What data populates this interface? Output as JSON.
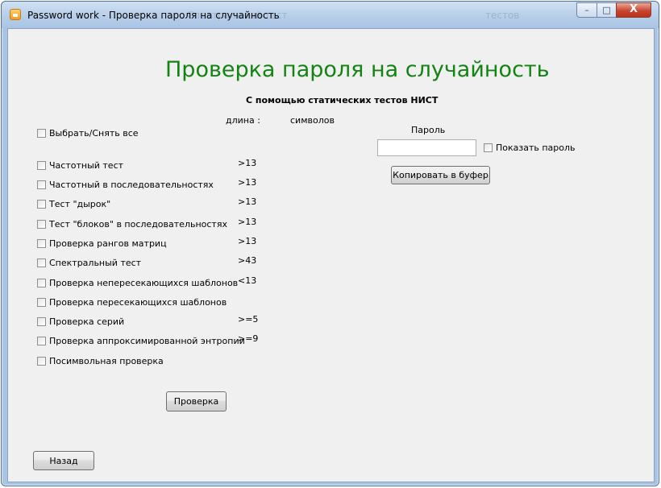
{
  "window": {
    "title": "Password work - Проверка пароля на случайность",
    "ghost_tabs": [
      "Спектральный тест",
      "тестов"
    ],
    "controls": {
      "minimize": "–",
      "maximize": "□",
      "close": "X"
    }
  },
  "header": {
    "title": "Проверка пароля на случайность",
    "subtitle": "С помощью статических тестов НИСТ"
  },
  "length": {
    "label": "длина :",
    "value": "",
    "unit": "символов"
  },
  "select_all_label": "Выбрать/Снять все",
  "tests": [
    {
      "label": "Частотный тест",
      "threshold": ">13"
    },
    {
      "label": "Частотный в последовательностях",
      "threshold": ">13"
    },
    {
      "label": "Тест \"дырок\"",
      "threshold": ">13"
    },
    {
      "label": "Тест \"блоков\" в последовательностях",
      "threshold": ">13"
    },
    {
      "label": "Проверка рангов матриц",
      "threshold": ">13"
    },
    {
      "label": "Спектральный тест",
      "threshold": ">43"
    },
    {
      "label": "Проверка непересекающихся шаблонов",
      "threshold": "<13"
    },
    {
      "label": "Проверка пересекающихся шаблонов",
      "threshold": ""
    },
    {
      "label": "Проверка серий",
      "threshold": ">=5"
    },
    {
      "label": "Проверка аппроксимированной энтропии",
      "threshold": ">=9"
    },
    {
      "label": "Посимвольная проверка",
      "threshold": ""
    }
  ],
  "password": {
    "label": "Пароль",
    "value": "",
    "show_label": "Показать пароль",
    "copy_button": "Копировать в буфер"
  },
  "check_button": "Проверка",
  "back_button": "Назад"
}
